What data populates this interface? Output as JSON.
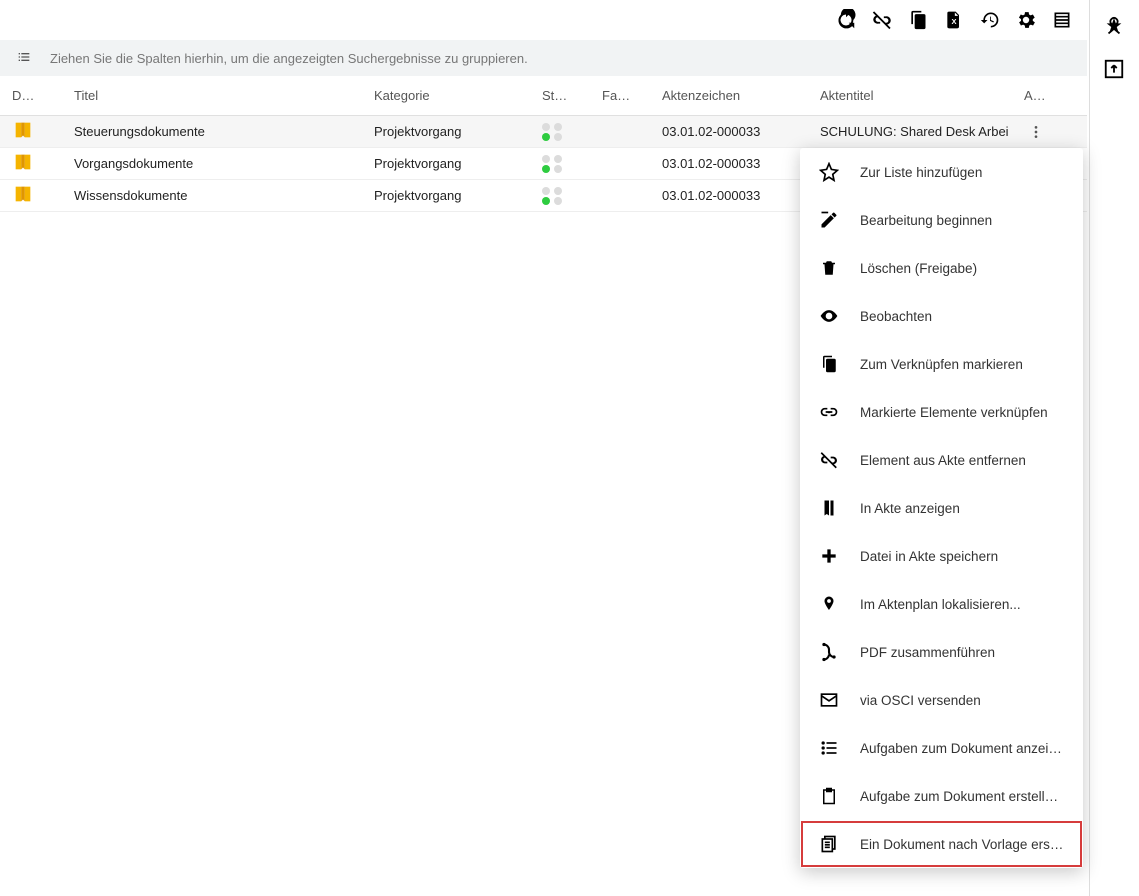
{
  "group_hint": "Ziehen Sie die Spalten hierhin, um die angezeigten Suchergebnisse zu gruppieren.",
  "headers": {
    "d": "D…",
    "titel": "Titel",
    "kategorie": "Kategorie",
    "st": "St…",
    "fa": "Fa…",
    "aktenzeichen": "Aktenzeichen",
    "aktentitel": "Aktentitel",
    "a": "A…"
  },
  "rows": [
    {
      "titel": "Steuerungsdokumente",
      "kategorie": "Projektvorgang",
      "aktenzeichen": "03.01.02-000033",
      "aktentitel": "SCHULUNG: Shared Desk Arbei"
    },
    {
      "titel": "Vorgangsdokumente",
      "kategorie": "Projektvorgang",
      "aktenzeichen": "03.01.02-000033",
      "aktentitel": ""
    },
    {
      "titel": "Wissensdokumente",
      "kategorie": "Projektvorgang",
      "aktenzeichen": "03.01.02-000033",
      "aktentitel": ""
    }
  ],
  "context_menu": [
    {
      "label": "Zur Liste hinzufügen"
    },
    {
      "label": "Bearbeitung beginnen"
    },
    {
      "label": "Löschen (Freigabe)"
    },
    {
      "label": "Beobachten"
    },
    {
      "label": "Zum Verknüpfen markieren"
    },
    {
      "label": "Markierte Elemente verknüpfen"
    },
    {
      "label": "Element aus Akte entfernen"
    },
    {
      "label": "In Akte anzeigen"
    },
    {
      "label": "Datei in Akte speichern"
    },
    {
      "label": "Im Aktenplan lokalisieren..."
    },
    {
      "label": "PDF zusammenführen"
    },
    {
      "label": "via OSCI versenden"
    },
    {
      "label": "Aufgaben zum Dokument anzei…"
    },
    {
      "label": "Aufgabe zum Dokument erstell…"
    },
    {
      "label": "Ein Dokument nach Vorlage ers…"
    }
  ]
}
